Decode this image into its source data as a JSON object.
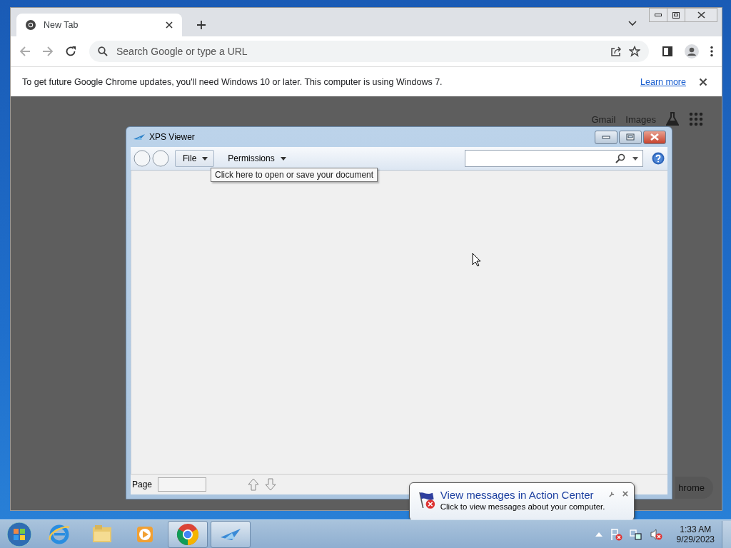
{
  "browser": {
    "tabs": [
      {
        "title": "New Tab",
        "selected": true
      }
    ],
    "address": {
      "placeholder": "Search Google or type a URL"
    },
    "infobar": {
      "message": "To get future Google Chrome updates, you'll need Windows 10 or later. This computer is using Windows 7.",
      "link": "Learn more"
    },
    "page": {
      "links": [
        "Gmail",
        "Images"
      ],
      "partial_button": "hrome"
    }
  },
  "xps": {
    "title": "XPS Viewer",
    "menus": [
      "File",
      "Permissions"
    ],
    "tooltip": "Click here to open or save your document",
    "page_label": "Page"
  },
  "balloon": {
    "title": "View messages in Action Center",
    "text": "Click to view messages about your computer."
  },
  "taskbar": {
    "apps": [
      {
        "kind": "ie",
        "running": false
      },
      {
        "kind": "explorer",
        "running": false
      },
      {
        "kind": "media",
        "running": false
      },
      {
        "kind": "chrome",
        "running": true
      },
      {
        "kind": "xps",
        "running": true
      }
    ],
    "time": "1:33 AM",
    "date": "9/29/2023"
  }
}
